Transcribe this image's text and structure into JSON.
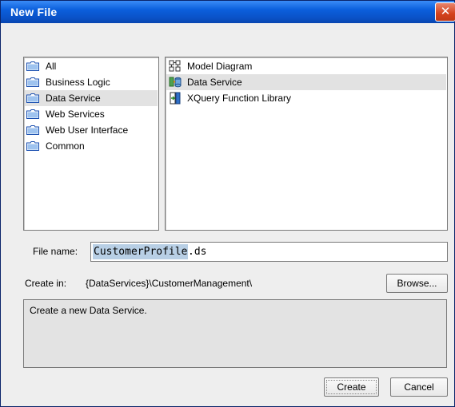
{
  "window": {
    "title": "New File",
    "close_glyph": "✕"
  },
  "categories": {
    "items": [
      {
        "label": "All",
        "icon": "folder-icon",
        "selected": false
      },
      {
        "label": "Business Logic",
        "icon": "folder-icon",
        "selected": false
      },
      {
        "label": "Data Service",
        "icon": "folder-icon",
        "selected": true
      },
      {
        "label": "Web Services",
        "icon": "folder-icon",
        "selected": false
      },
      {
        "label": "Web User Interface",
        "icon": "folder-icon",
        "selected": false
      },
      {
        "label": "Common",
        "icon": "folder-icon",
        "selected": false
      }
    ]
  },
  "templates": {
    "items": [
      {
        "label": "Model Diagram",
        "icon": "model-diagram-icon",
        "selected": false
      },
      {
        "label": "Data Service",
        "icon": "data-service-icon",
        "selected": true
      },
      {
        "label": "XQuery Function Library",
        "icon": "xquery-library-icon",
        "selected": false
      }
    ]
  },
  "file_name": {
    "label": "File name:",
    "value_selected": "CustomerProfile",
    "value_extension": ".ds"
  },
  "create_in": {
    "label": "Create in:",
    "path": "{DataServices}\\CustomerManagement\\",
    "browse_label": "Browse..."
  },
  "description": {
    "text": "Create a new Data Service."
  },
  "buttons": {
    "create_label": "Create",
    "cancel_label": "Cancel"
  },
  "colors": {
    "title_bar": "#0a52c8",
    "selection": "#e2e2e2",
    "text_selection": "#b8cfe5",
    "close_button": "#d4421d"
  }
}
